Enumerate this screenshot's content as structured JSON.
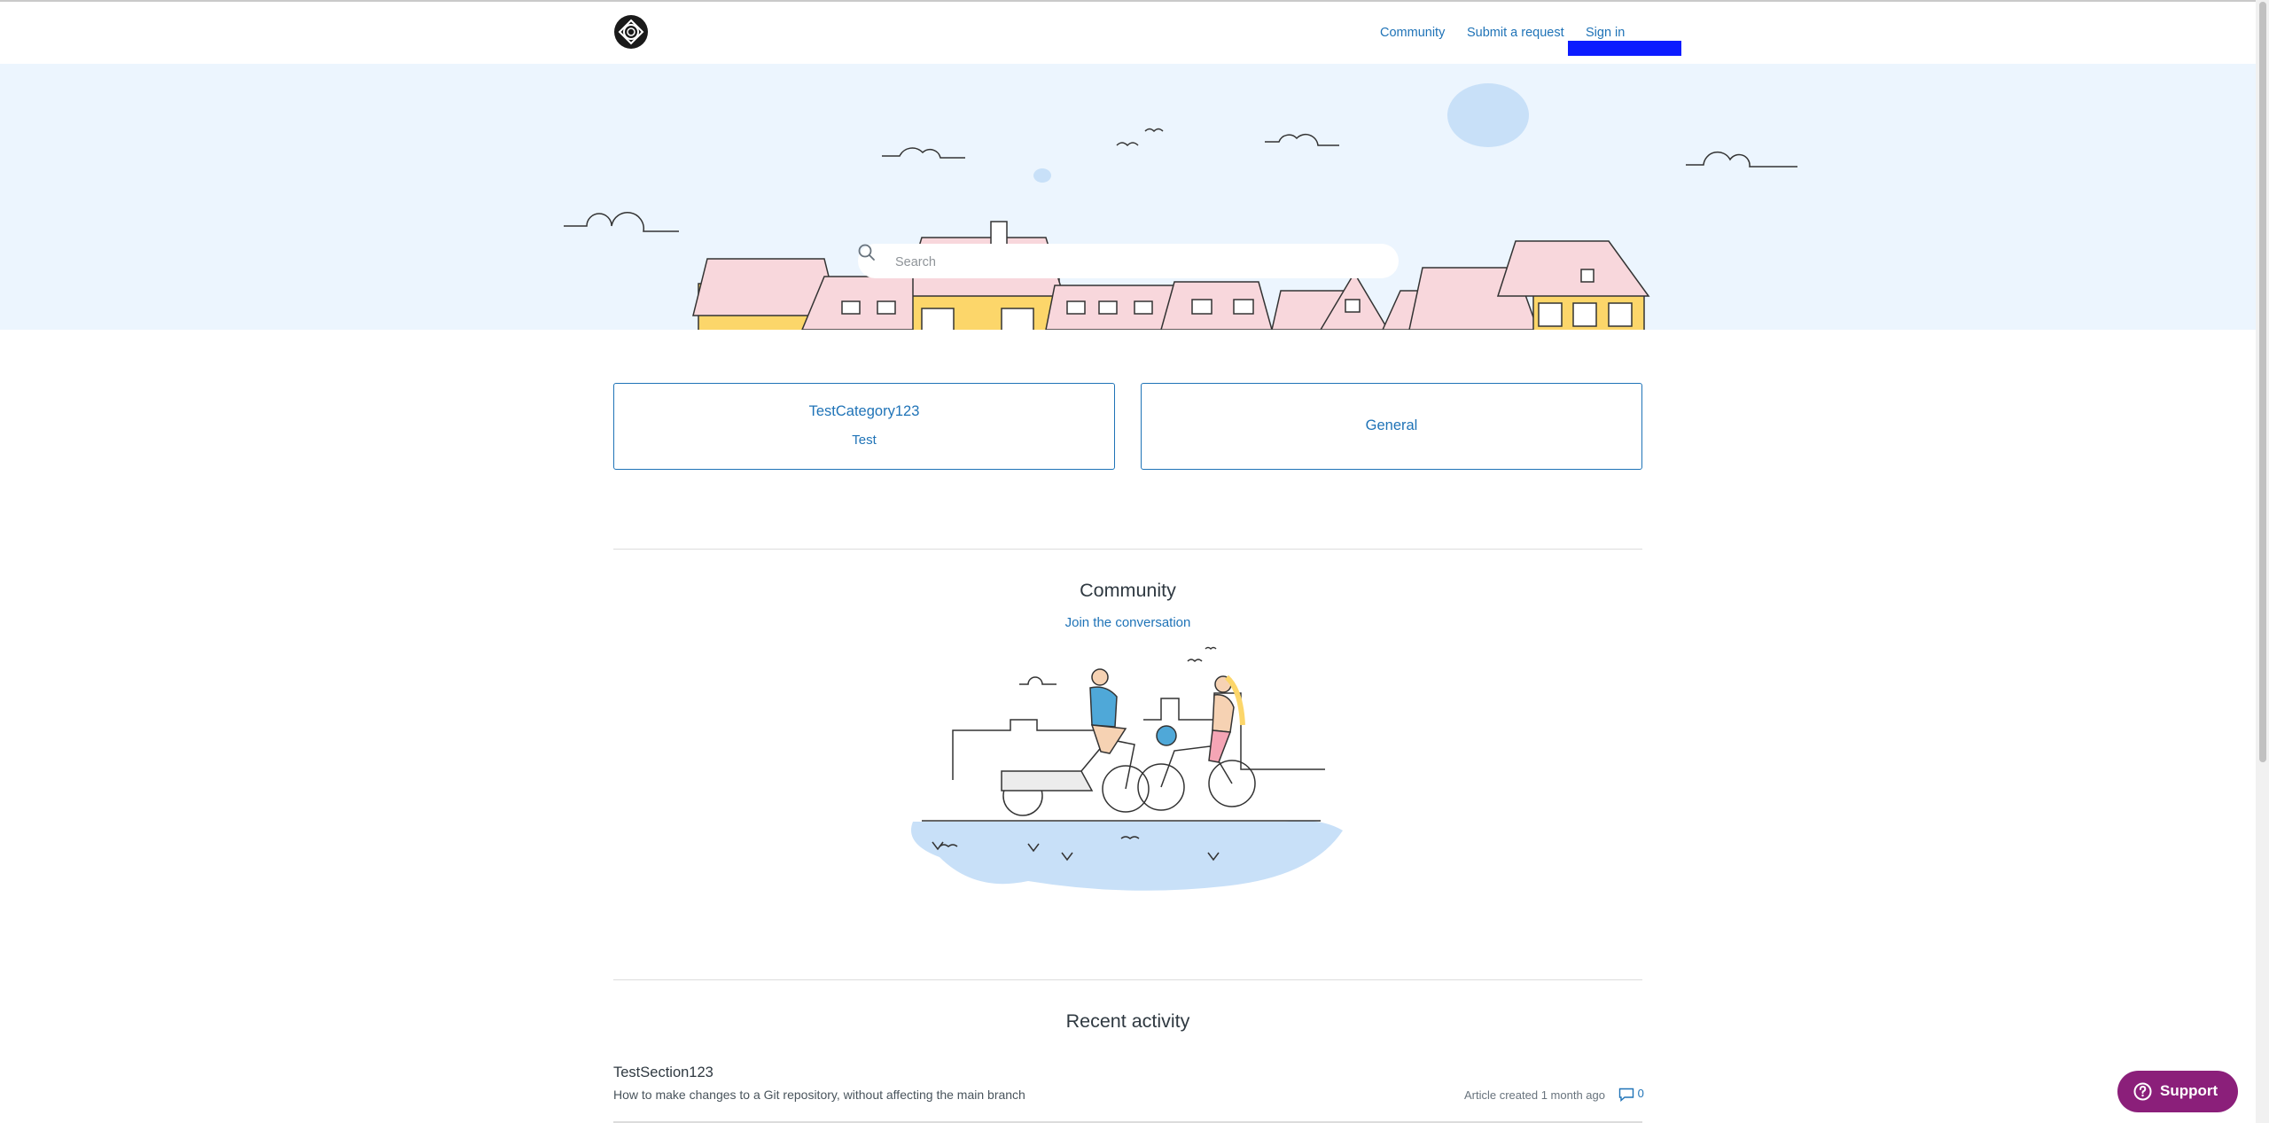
{
  "header": {
    "nav": {
      "community": "Community",
      "submit_request": "Submit a request",
      "sign_in": "Sign in"
    },
    "logo_icon": "brand-logo-icon"
  },
  "hero": {
    "search": {
      "placeholder": "Search",
      "icon": "search-icon"
    }
  },
  "categories": [
    {
      "title": "TestCategory123",
      "description": "Test"
    },
    {
      "title": "General",
      "description": ""
    }
  ],
  "community": {
    "title": "Community",
    "link": "Join the conversation"
  },
  "recent_activity": {
    "title": "Recent activity",
    "items": [
      {
        "section": "TestSection123",
        "title": "How to make changes to a Git repository, without affecting the main branch",
        "meta": "Article created 1 month ago",
        "comments": "0"
      }
    ]
  },
  "support_button": {
    "label": "Support"
  },
  "colors": {
    "link": "#1f73b7",
    "hero_bg": "#ecf5fe",
    "support": "#8b1f7a"
  }
}
